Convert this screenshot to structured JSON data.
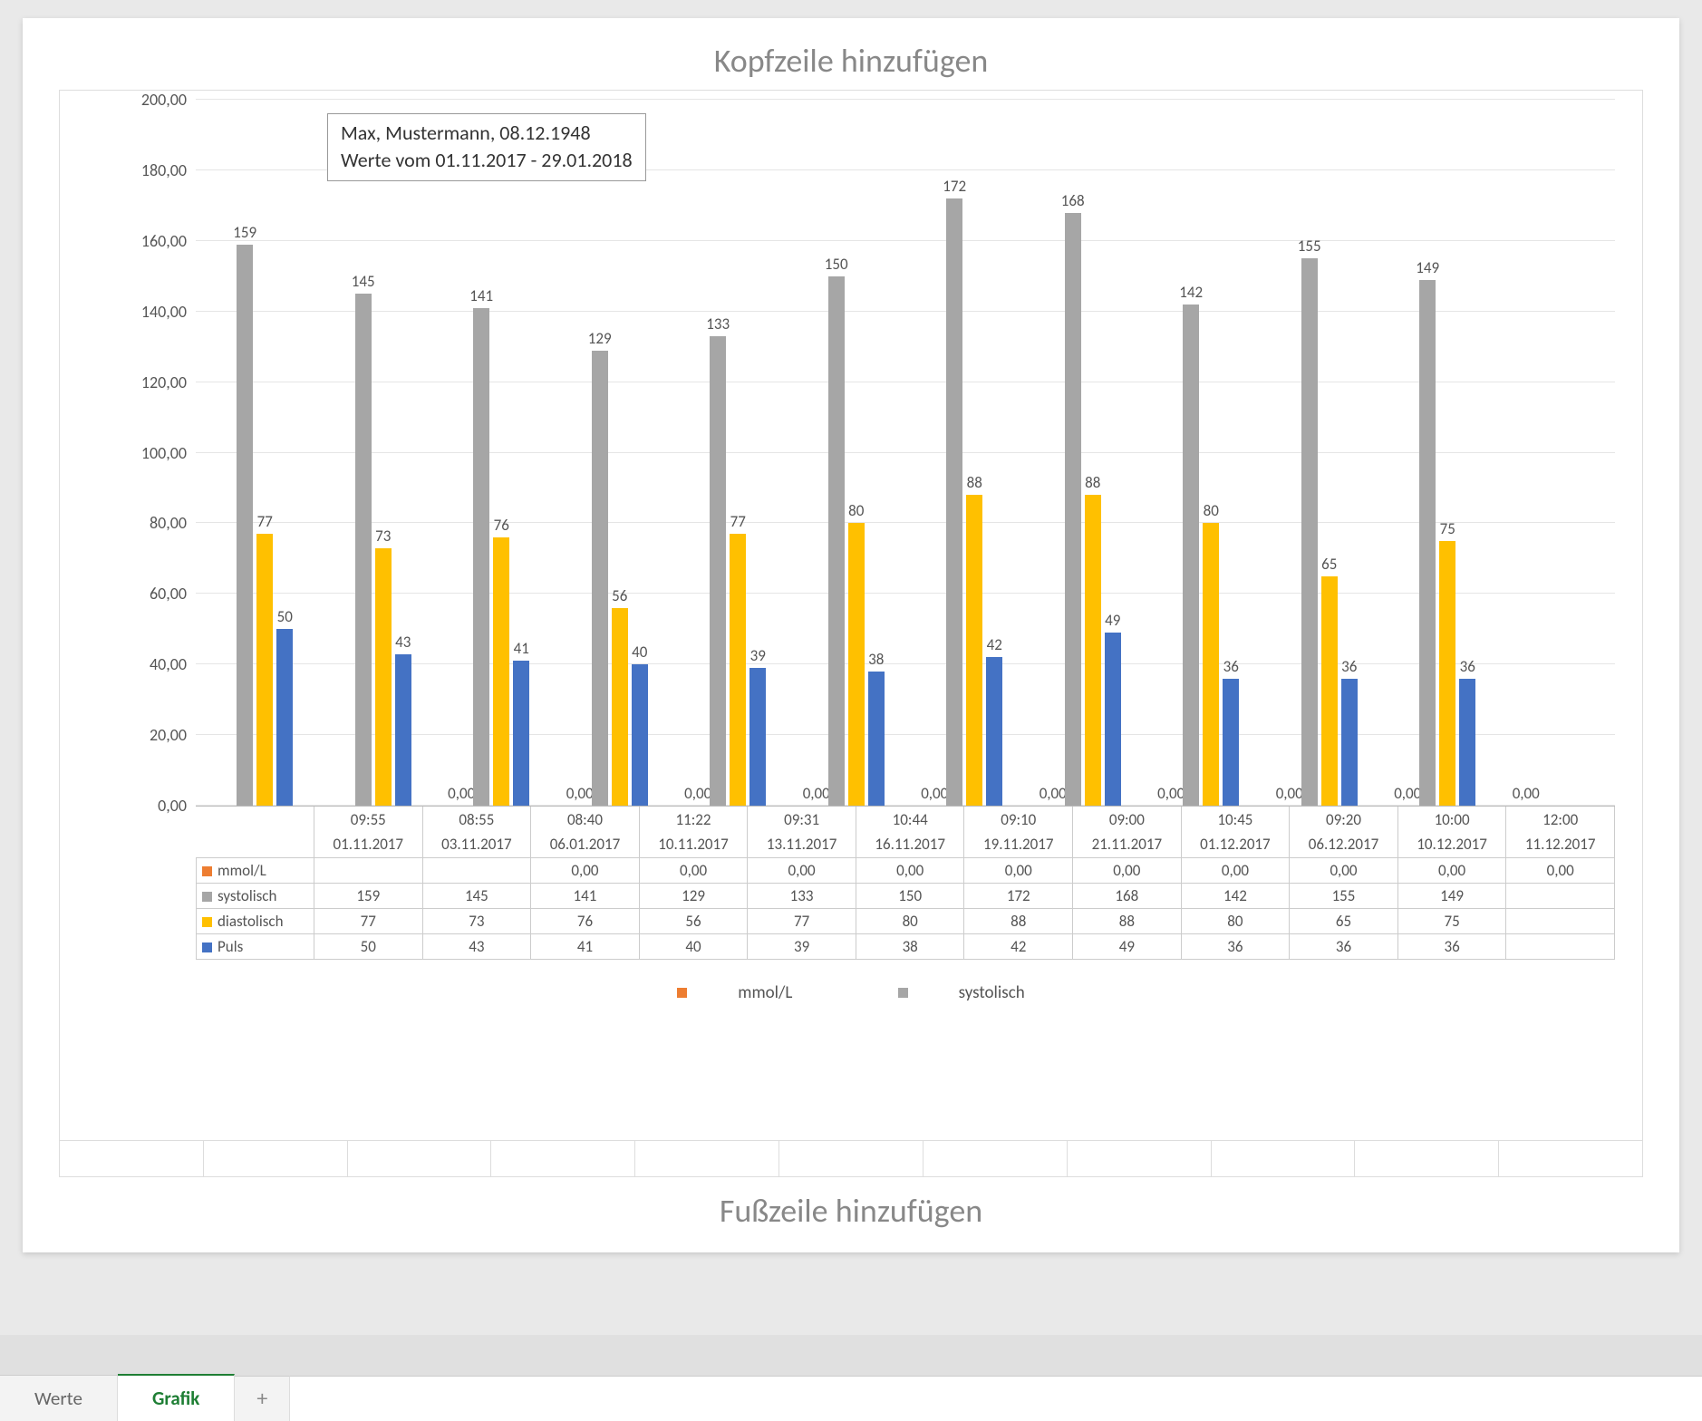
{
  "header_placeholder": "Kopfzeile hinzufügen",
  "footer_placeholder": "Fußzeile hinzufügen",
  "info_box": {
    "line1": "Max, Mustermann, 08.12.1948",
    "line2": "Werte vom 01.11.2017 - 29.01.2018"
  },
  "tabs": {
    "werte": "Werte",
    "grafik": "Grafik",
    "add": "+"
  },
  "legend": {
    "mmol": "mmol/L",
    "systolisch": "systolisch",
    "diastolisch": "diastolisch",
    "puls": "Puls"
  },
  "colors": {
    "mmol": "#ed7d31",
    "systolisch": "#a6a6a6",
    "diastolisch": "#ffc000",
    "puls": "#4472c4"
  },
  "chart_data": {
    "type": "bar",
    "ylim": [
      0,
      200
    ],
    "yticks": [
      "0,00",
      "20,00",
      "40,00",
      "60,00",
      "80,00",
      "100,00",
      "120,00",
      "140,00",
      "160,00",
      "180,00",
      "200,00"
    ],
    "categories_time": [
      "09:55",
      "08:55",
      "08:40",
      "11:22",
      "09:31",
      "10:44",
      "09:10",
      "09:00",
      "10:45",
      "09:20",
      "10:00",
      "12:00"
    ],
    "categories_date": [
      "01.11.2017",
      "03.11.2017",
      "06.01.2017",
      "10.11.2017",
      "13.11.2017",
      "16.11.2017",
      "19.11.2017",
      "21.11.2017",
      "01.12.2017",
      "06.12.2017",
      "10.12.2017",
      "11.12.2017"
    ],
    "series": [
      {
        "name": "mmol/L",
        "key": "mmol",
        "values": [
          null,
          null,
          0.0,
          0.0,
          0.0,
          0.0,
          0.0,
          0.0,
          0.0,
          0.0,
          0.0,
          0.0
        ]
      },
      {
        "name": "systolisch",
        "key": "systolisch",
        "values": [
          159,
          145,
          141,
          129,
          133,
          150,
          172,
          168,
          142,
          155,
          149,
          null
        ]
      },
      {
        "name": "diastolisch",
        "key": "diastolisch",
        "values": [
          77,
          73,
          76,
          56,
          77,
          80,
          88,
          88,
          80,
          65,
          75,
          null
        ]
      },
      {
        "name": "Puls",
        "key": "puls",
        "values": [
          50,
          43,
          41,
          40,
          39,
          38,
          42,
          49,
          36,
          36,
          36,
          null
        ]
      }
    ],
    "table_values": {
      "mmol": [
        "",
        "",
        "0,00",
        "0,00",
        "0,00",
        "0,00",
        "0,00",
        "0,00",
        "0,00",
        "0,00",
        "0,00",
        "0,00"
      ],
      "systolisch": [
        "159",
        "145",
        "141",
        "129",
        "133",
        "150",
        "172",
        "168",
        "142",
        "155",
        "149",
        ""
      ],
      "diastolisch": [
        "77",
        "73",
        "76",
        "56",
        "77",
        "80",
        "88",
        "88",
        "80",
        "65",
        "75",
        ""
      ],
      "puls": [
        "50",
        "43",
        "41",
        "40",
        "39",
        "38",
        "42",
        "49",
        "36",
        "36",
        "36",
        ""
      ]
    }
  }
}
